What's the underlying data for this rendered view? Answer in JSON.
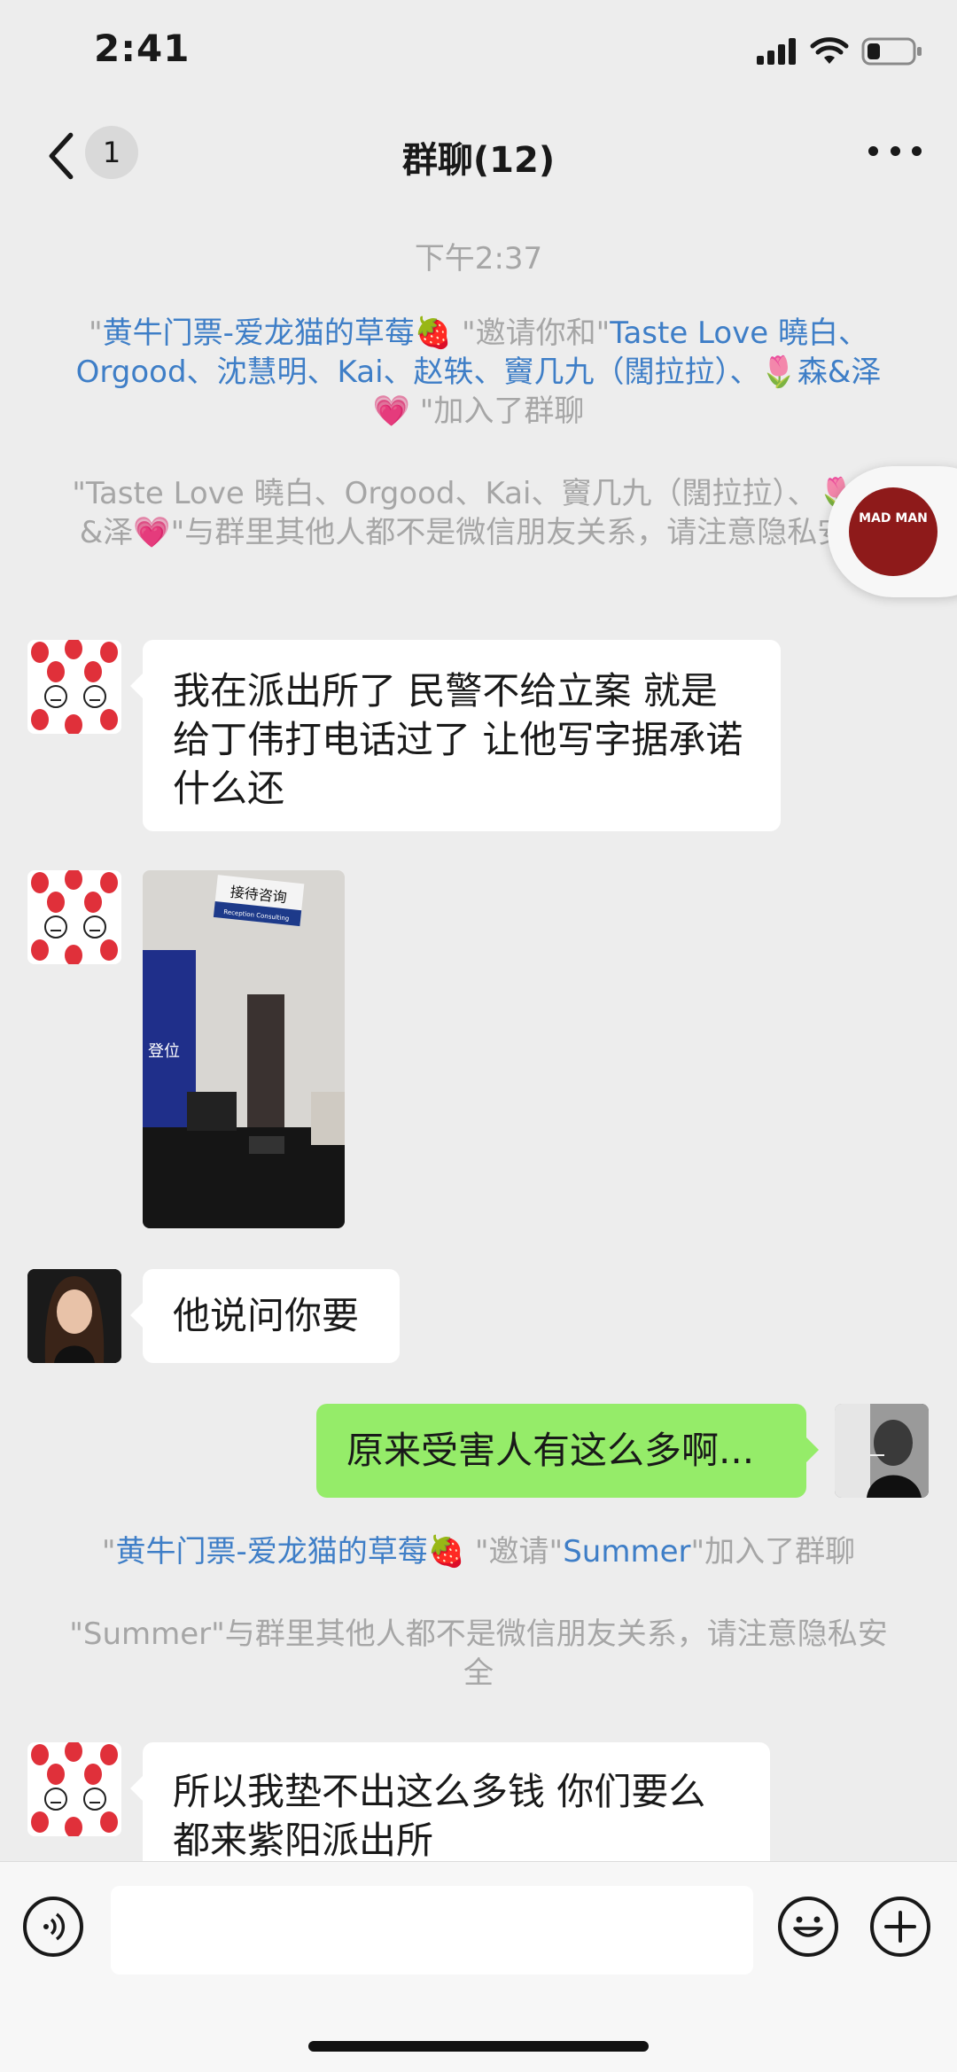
{
  "status_bar": {
    "time": "2:41"
  },
  "header": {
    "back_badge": "1",
    "title": "群聊(12)"
  },
  "timestamp": "下午2:37",
  "system_notes": [
    {
      "inviter": "黄牛门票-爱龙猫的草莓🍓",
      "action_mid": "\"邀请你和\"",
      "invitees": "Taste Love 曉白、Orgood、沈慧明、Kai、赵轶、竇几九（闊拉拉）、🌷森&泽💗",
      "action_end": "\"加入了群聊"
    },
    {
      "text": "\"Taste Love 曉白、Orgood、Kai、竇几九（闊拉拉）、🌷森&泽💗\"与群里其他人都不是微信朋友关系，请注意隐私安全"
    }
  ],
  "messages": [
    {
      "side": "left",
      "sender": "strawberry",
      "text": "我在派出所了 民警不给立案 就是给丁伟打电话过了 让他写字据承诺什么还"
    },
    {
      "side": "left",
      "sender": "strawberry",
      "photo_sign": "接待咨询",
      "photo_sign_en": "Reception Consulting",
      "photo_wall_text": "登位"
    },
    {
      "side": "left",
      "sender": "woman",
      "text": "他说问你要"
    },
    {
      "side": "right",
      "sender": "me",
      "text": "原来受害人有这么多啊..."
    },
    {
      "side": "left",
      "sender": "strawberry",
      "text": "所以我垫不出这么多钱 你们要么都来紫阳派出所"
    }
  ],
  "system_notes_2": [
    {
      "inviter": "黄牛门票-爱龙猫的草莓🍓",
      "action_mid": "\"邀请\"",
      "invitee": "Summer",
      "action_end": "\"加入了群聊"
    },
    {
      "text": "\"Summer\"与群里其他人都不是微信朋友关系，请注意隐私安全"
    }
  ],
  "floating_widget": {
    "label": "MAD MAN"
  },
  "colors": {
    "background": "#ededed",
    "bubble_left": "#ffffff",
    "bubble_right": "#95ec69",
    "link_blue": "#3e7ec7",
    "system_text": "#a6a6a6"
  }
}
